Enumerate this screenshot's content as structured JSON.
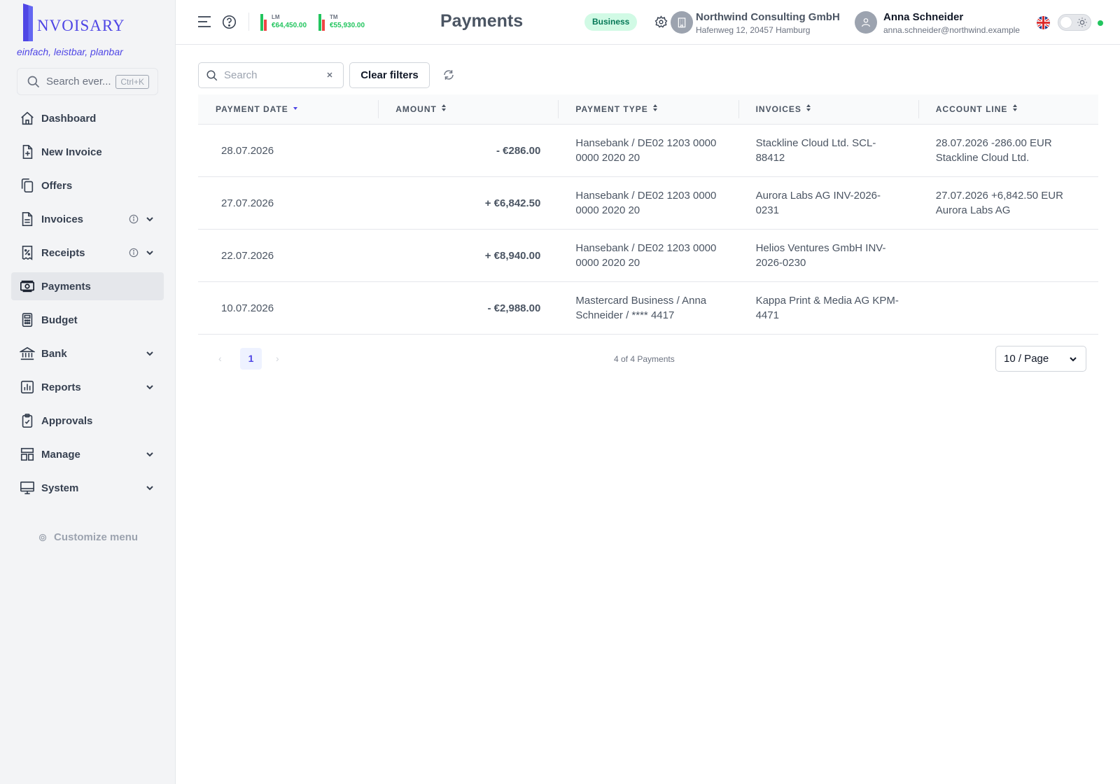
{
  "brand": {
    "logo_text": "NVOISARY",
    "tagline": "einfach, leistbar, planbar"
  },
  "sidebar": {
    "search_placeholder": "Search ever...",
    "search_shortcut": "Ctrl+K",
    "items": [
      {
        "label": "Dashboard",
        "icon": "home-icon"
      },
      {
        "label": "New Invoice",
        "icon": "file-plus-icon"
      },
      {
        "label": "Offers",
        "icon": "copy-icon"
      },
      {
        "label": "Invoices",
        "icon": "file-text-icon",
        "info": true,
        "expandable": true
      },
      {
        "label": "Receipts",
        "icon": "receipt-icon",
        "info": true,
        "expandable": true
      },
      {
        "label": "Payments",
        "icon": "banknote-icon",
        "active": true
      },
      {
        "label": "Budget",
        "icon": "calculator-icon"
      },
      {
        "label": "Bank",
        "icon": "bank-icon",
        "expandable": true
      },
      {
        "label": "Reports",
        "icon": "bar-chart-icon",
        "expandable": true
      },
      {
        "label": "Approvals",
        "icon": "clipboard-check-icon"
      },
      {
        "label": "Manage",
        "icon": "layout-icon",
        "expandable": true
      },
      {
        "label": "System",
        "icon": "monitor-icon",
        "expandable": true
      }
    ],
    "customize_label": "Customize menu"
  },
  "header": {
    "title": "Payments",
    "last_month": {
      "label": "LM",
      "value": "€64,450.00"
    },
    "this_month": {
      "label": "TM",
      "value": "€55,930.00"
    },
    "badge": "Business",
    "company": {
      "name": "Northwind Consulting GmbH",
      "address": "Hafenweg 12, 20457 Hamburg"
    },
    "user": {
      "name": "Anna Schneider",
      "email": "anna.schneider@northwind.example"
    },
    "colors": {
      "accent": "#4f46e5",
      "positive": "#22c55e",
      "negative": "#ef4444"
    }
  },
  "filters": {
    "search_placeholder": "Search",
    "search_value": "",
    "clear_label": "Clear filters"
  },
  "table": {
    "columns": [
      "PAYMENT DATE",
      "AMOUNT",
      "PAYMENT TYPE",
      "INVOICES",
      "ACCOUNT LINE"
    ],
    "sorted_column": "PAYMENT DATE",
    "rows": [
      {
        "date": "28.07.2026",
        "amount": "- €286.00",
        "type": "Hansebank / DE02 1203 0000 0000 2020 20",
        "invoice": "Stackline Cloud Ltd. SCL-88412",
        "account": "28.07.2026 -286.00 EUR Stackline Cloud Ltd."
      },
      {
        "date": "27.07.2026",
        "amount": "+ €6,842.50",
        "type": "Hansebank / DE02 1203 0000 0000 2020 20",
        "invoice": "Aurora Labs AG INV-2026-0231",
        "account": "27.07.2026 +6,842.50 EUR Aurora Labs AG"
      },
      {
        "date": "22.07.2026",
        "amount": "+ €8,940.00",
        "type": "Hansebank / DE02 1203 0000 0000 2020 20",
        "invoice": "Helios Ventures GmbH INV-2026-0230",
        "account": ""
      },
      {
        "date": "10.07.2026",
        "amount": "- €2,988.00",
        "type": "Mastercard Business / Anna Schneider / **** 4417",
        "invoice": "Kappa Print & Media AG KPM-4471",
        "account": ""
      }
    ]
  },
  "pagination": {
    "prev": "‹",
    "current": "1",
    "next": "›",
    "count": "4 of 4 Payments",
    "page_size": "10 / Page"
  }
}
